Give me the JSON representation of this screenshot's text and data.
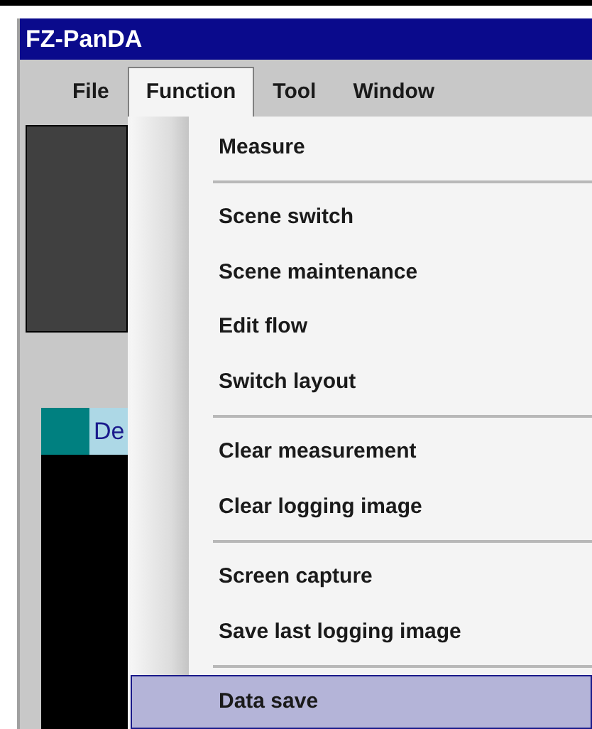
{
  "window": {
    "title": "FZ-PanDA"
  },
  "menu_bar": [
    {
      "label": "File",
      "selected": false
    },
    {
      "label": "Function",
      "selected": true
    },
    {
      "label": "Tool",
      "selected": false
    },
    {
      "label": "Window",
      "selected": false
    }
  ],
  "side_panel": {
    "tab_label": "De"
  },
  "dropdown": [
    {
      "kind": "item",
      "label": "Measure",
      "selected": false
    },
    {
      "kind": "separator"
    },
    {
      "kind": "item",
      "label": "Scene switch",
      "selected": false
    },
    {
      "kind": "item",
      "label": "Scene maintenance",
      "selected": false
    },
    {
      "kind": "item",
      "label": "Edit flow",
      "selected": false
    },
    {
      "kind": "item",
      "label": "Switch layout",
      "selected": false
    },
    {
      "kind": "separator"
    },
    {
      "kind": "item",
      "label": "Clear measurement",
      "selected": false
    },
    {
      "kind": "item",
      "label": "Clear logging image",
      "selected": false
    },
    {
      "kind": "separator"
    },
    {
      "kind": "item",
      "label": "Screen capture",
      "selected": false
    },
    {
      "kind": "item",
      "label": "Save last logging image",
      "selected": false
    },
    {
      "kind": "separator"
    },
    {
      "kind": "item",
      "label": "Data save",
      "selected": true
    }
  ]
}
